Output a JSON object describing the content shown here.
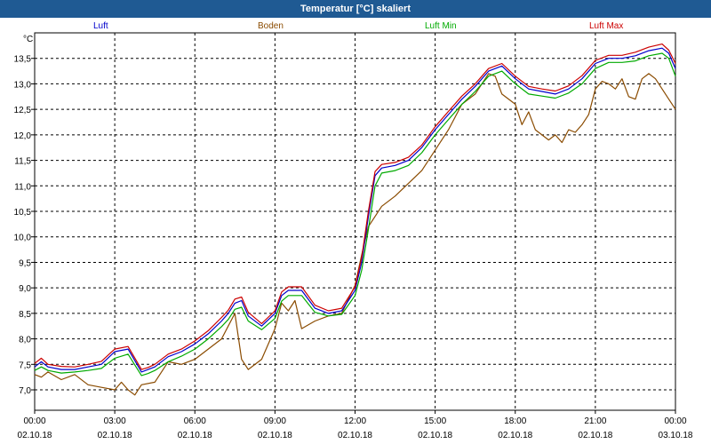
{
  "window": {
    "title": "Temperatur [°C] skaliert"
  },
  "chart_data": {
    "type": "line",
    "unit": "°C",
    "ylim": [
      6.6,
      14.0
    ],
    "yticks": [
      "7,0",
      "7,5",
      "8,0",
      "8,5",
      "9,0",
      "9,5",
      "10,0",
      "10,5",
      "11,0",
      "11,5",
      "12,0",
      "12,5",
      "13,0",
      "13,5"
    ],
    "ytick_values": [
      7.0,
      7.5,
      8.0,
      8.5,
      9.0,
      9.5,
      10.0,
      10.5,
      11.0,
      11.5,
      12.0,
      12.5,
      13.0,
      13.5
    ],
    "xlim": [
      0,
      24
    ],
    "xtick_hours": [
      0,
      3,
      6,
      9,
      12,
      15,
      18,
      21,
      24
    ],
    "xtick_times": [
      "00:00",
      "03:00",
      "06:00",
      "09:00",
      "12:00",
      "15:00",
      "18:00",
      "21:00",
      "00:00"
    ],
    "xtick_dates": [
      "02.10.18",
      "02.10.18",
      "02.10.18",
      "02.10.18",
      "02.10.18",
      "02.10.18",
      "02.10.18",
      "02.10.18",
      "03.10.18"
    ],
    "grid": true,
    "legend_position": "top",
    "series": [
      {
        "name": "Luft",
        "color": "#0000cc",
        "x": [
          0,
          0.25,
          0.5,
          1,
          1.5,
          2,
          2.5,
          3,
          3.5,
          4,
          4.25,
          4.5,
          5,
          5.5,
          6,
          6.5,
          7,
          7.25,
          7.5,
          7.75,
          8,
          8.5,
          9,
          9.25,
          9.5,
          10,
          10.5,
          11,
          11.5,
          12,
          12.25,
          12.5,
          12.75,
          13,
          13.5,
          14,
          14.5,
          15,
          15.5,
          16,
          16.5,
          17,
          17.5,
          18,
          18.5,
          19,
          19.5,
          20,
          20.5,
          21,
          21.5,
          22,
          22.5,
          23,
          23.5,
          23.75,
          24
        ],
        "values": [
          7.45,
          7.55,
          7.45,
          7.4,
          7.4,
          7.45,
          7.5,
          7.75,
          7.8,
          7.35,
          7.4,
          7.45,
          7.65,
          7.75,
          7.9,
          8.1,
          8.35,
          8.5,
          8.7,
          8.75,
          8.45,
          8.25,
          8.5,
          8.85,
          8.95,
          8.95,
          8.6,
          8.5,
          8.55,
          8.95,
          9.5,
          10.4,
          11.2,
          11.35,
          11.4,
          11.5,
          11.75,
          12.1,
          12.4,
          12.7,
          12.95,
          13.25,
          13.35,
          13.1,
          12.9,
          12.85,
          12.8,
          12.9,
          13.1,
          13.4,
          13.5,
          13.5,
          13.55,
          13.65,
          13.7,
          13.6,
          13.3
        ]
      },
      {
        "name": "Boden",
        "color": "#8a4b00",
        "x": [
          0,
          0.25,
          0.5,
          1,
          1.5,
          2,
          2.5,
          3,
          3.25,
          3.5,
          3.75,
          4,
          4.5,
          5,
          5.5,
          6,
          6.5,
          7,
          7.5,
          7.75,
          8,
          8.5,
          9,
          9.25,
          9.5,
          9.75,
          10,
          10.5,
          11,
          11.5,
          12,
          12.25,
          12.5,
          13,
          13.5,
          14,
          14.5,
          15,
          15.5,
          16,
          16.5,
          17,
          17.25,
          17.5,
          18,
          18.25,
          18.5,
          18.75,
          19,
          19.25,
          19.5,
          19.75,
          20,
          20.25,
          20.5,
          20.75,
          21,
          21.25,
          21.5,
          21.75,
          22,
          22.25,
          22.5,
          22.75,
          23,
          23.25,
          23.5,
          23.75,
          24
        ],
        "values": [
          7.3,
          7.25,
          7.35,
          7.2,
          7.3,
          7.1,
          7.05,
          7.0,
          7.15,
          7.0,
          6.9,
          7.1,
          7.15,
          7.55,
          7.5,
          7.6,
          7.8,
          8.0,
          8.5,
          7.6,
          7.4,
          7.6,
          8.2,
          8.7,
          8.55,
          8.75,
          8.2,
          8.35,
          8.45,
          8.5,
          9.05,
          9.65,
          10.2,
          10.6,
          10.8,
          11.05,
          11.3,
          11.7,
          12.1,
          12.6,
          12.8,
          13.2,
          13.15,
          12.8,
          12.6,
          12.2,
          12.45,
          12.1,
          12.0,
          11.9,
          12.0,
          11.85,
          12.1,
          12.05,
          12.2,
          12.4,
          12.9,
          13.05,
          13.0,
          12.9,
          13.1,
          12.75,
          12.7,
          13.1,
          13.2,
          13.1,
          12.9,
          12.7,
          12.5
        ]
      },
      {
        "name": "Luft Min",
        "color": "#00aa00",
        "x": [
          0,
          0.25,
          0.5,
          1,
          1.5,
          2,
          2.5,
          3,
          3.5,
          4,
          4.25,
          4.5,
          5,
          5.5,
          6,
          6.5,
          7,
          7.25,
          7.5,
          7.75,
          8,
          8.5,
          9,
          9.25,
          9.5,
          10,
          10.5,
          11,
          11.5,
          12,
          12.25,
          12.5,
          12.75,
          13,
          13.5,
          14,
          14.5,
          15,
          15.5,
          16,
          16.5,
          17,
          17.5,
          18,
          18.5,
          19,
          19.5,
          20,
          20.5,
          21,
          21.5,
          22,
          22.5,
          23,
          23.5,
          23.75,
          24
        ],
        "values": [
          7.38,
          7.45,
          7.38,
          7.33,
          7.35,
          7.38,
          7.42,
          7.62,
          7.7,
          7.28,
          7.32,
          7.38,
          7.55,
          7.66,
          7.8,
          8.0,
          8.24,
          8.38,
          8.58,
          8.62,
          8.35,
          8.18,
          8.4,
          8.74,
          8.85,
          8.85,
          8.52,
          8.45,
          8.48,
          8.85,
          9.35,
          10.15,
          11.0,
          11.25,
          11.3,
          11.4,
          11.65,
          12.0,
          12.3,
          12.6,
          12.85,
          13.15,
          13.25,
          13.0,
          12.8,
          12.76,
          12.72,
          12.82,
          13.0,
          13.3,
          13.42,
          13.42,
          13.45,
          13.55,
          13.6,
          13.5,
          13.15
        ]
      },
      {
        "name": "Luft Max",
        "color": "#cc0000",
        "x": [
          0,
          0.25,
          0.5,
          1,
          1.5,
          2,
          2.5,
          3,
          3.5,
          4,
          4.25,
          4.5,
          5,
          5.5,
          6,
          6.5,
          7,
          7.25,
          7.5,
          7.75,
          8,
          8.5,
          9,
          9.25,
          9.5,
          10,
          10.5,
          11,
          11.5,
          12,
          12.25,
          12.5,
          12.75,
          13,
          13.5,
          14,
          14.5,
          15,
          15.5,
          16,
          16.5,
          17,
          17.5,
          18,
          18.5,
          19,
          19.5,
          20,
          20.5,
          21,
          21.5,
          22,
          22.5,
          23,
          23.5,
          23.75,
          24
        ],
        "values": [
          7.52,
          7.62,
          7.5,
          7.46,
          7.45,
          7.5,
          7.56,
          7.8,
          7.85,
          7.4,
          7.44,
          7.5,
          7.7,
          7.8,
          7.96,
          8.16,
          8.42,
          8.56,
          8.78,
          8.82,
          8.52,
          8.3,
          8.55,
          8.92,
          9.02,
          9.02,
          8.66,
          8.55,
          8.6,
          9.02,
          9.6,
          10.5,
          11.28,
          11.42,
          11.46,
          11.56,
          11.8,
          12.16,
          12.46,
          12.76,
          13.0,
          13.3,
          13.4,
          13.15,
          12.95,
          12.9,
          12.86,
          12.96,
          13.16,
          13.46,
          13.56,
          13.56,
          13.62,
          13.72,
          13.78,
          13.66,
          13.4
        ]
      }
    ]
  }
}
